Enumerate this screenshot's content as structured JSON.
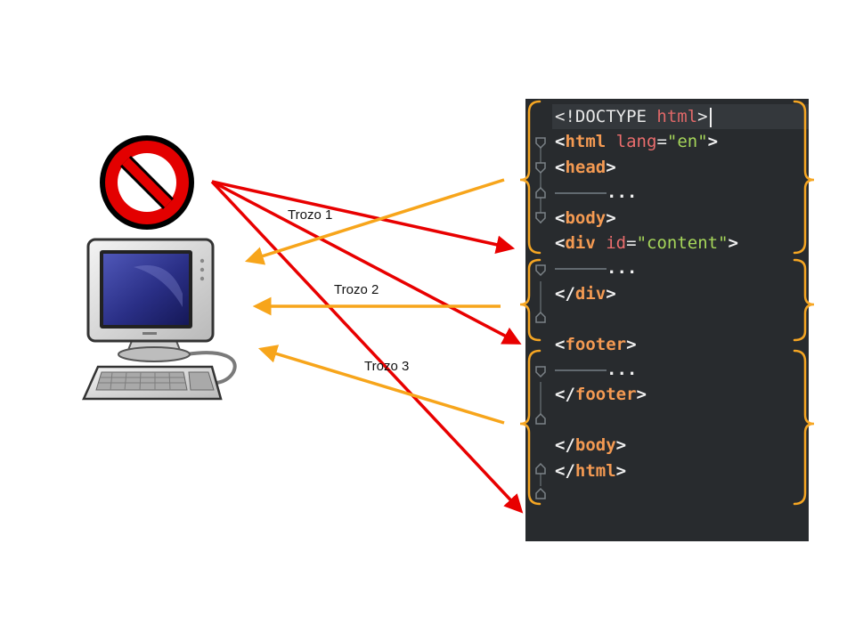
{
  "chunk_labels": [
    "Trozo 1",
    "Trozo 2",
    "Trozo 3"
  ],
  "code_lines": [
    [
      {
        "t": "<!DOCTYPE ",
        "c": "t-plain"
      },
      {
        "t": "html",
        "c": "t-kw"
      },
      {
        "t": ">",
        "c": "t-plain"
      }
    ],
    [
      {
        "t": "<",
        "c": "t-bracket"
      },
      {
        "t": "html",
        "c": "t-tag"
      },
      {
        "t": " ",
        "c": "t-plain"
      },
      {
        "t": "lang",
        "c": "t-attr"
      },
      {
        "t": "=",
        "c": "t-eq"
      },
      {
        "t": "\"en\"",
        "c": "t-str"
      },
      {
        "t": ">",
        "c": "t-bracket"
      }
    ],
    [
      {
        "t": "<",
        "c": "t-bracket"
      },
      {
        "t": "head",
        "c": "t-tag"
      },
      {
        "t": ">",
        "c": "t-bracket"
      }
    ],
    [
      {
        "t": "...",
        "c": "t-dots"
      }
    ],
    [
      {
        "t": "<",
        "c": "t-bracket"
      },
      {
        "t": "body",
        "c": "t-tag"
      },
      {
        "t": ">",
        "c": "t-bracket"
      }
    ],
    [
      {
        "t": "<",
        "c": "t-bracket"
      },
      {
        "t": "div",
        "c": "t-tag"
      },
      {
        "t": " ",
        "c": "t-plain"
      },
      {
        "t": "id",
        "c": "t-attr"
      },
      {
        "t": "=",
        "c": "t-eq"
      },
      {
        "t": "\"content\"",
        "c": "t-str"
      },
      {
        "t": ">",
        "c": "t-bracket"
      }
    ],
    [
      {
        "t": "...",
        "c": "t-dots"
      }
    ],
    [
      {
        "t": "</",
        "c": "t-bracket"
      },
      {
        "t": "div",
        "c": "t-tag"
      },
      {
        "t": ">",
        "c": "t-bracket"
      }
    ],
    [],
    [
      {
        "t": "<",
        "c": "t-bracket"
      },
      {
        "t": "footer",
        "c": "t-tag"
      },
      {
        "t": ">",
        "c": "t-bracket"
      }
    ],
    [
      {
        "t": "...",
        "c": "t-dots"
      }
    ],
    [
      {
        "t": "</",
        "c": "t-bracket"
      },
      {
        "t": "footer",
        "c": "t-tag"
      },
      {
        "t": ">",
        "c": "t-bracket"
      }
    ],
    [],
    [
      {
        "t": "</",
        "c": "t-bracket"
      },
      {
        "t": "body",
        "c": "t-tag"
      },
      {
        "t": ">",
        "c": "t-bracket"
      }
    ],
    [
      {
        "t": "</",
        "c": "t-bracket"
      },
      {
        "t": "html",
        "c": "t-tag"
      },
      {
        "t": ">",
        "c": "t-bracket"
      }
    ]
  ],
  "icons": {
    "forbidden": "no-entry-sign-icon",
    "client": "desktop-computer-icon"
  },
  "colors": {
    "request_arrow": "#e80000",
    "response_arrow": "#f7a51b",
    "brace": "#f6a623",
    "editor_bg": "#282b2e",
    "forbidden_red": "#e30000"
  }
}
